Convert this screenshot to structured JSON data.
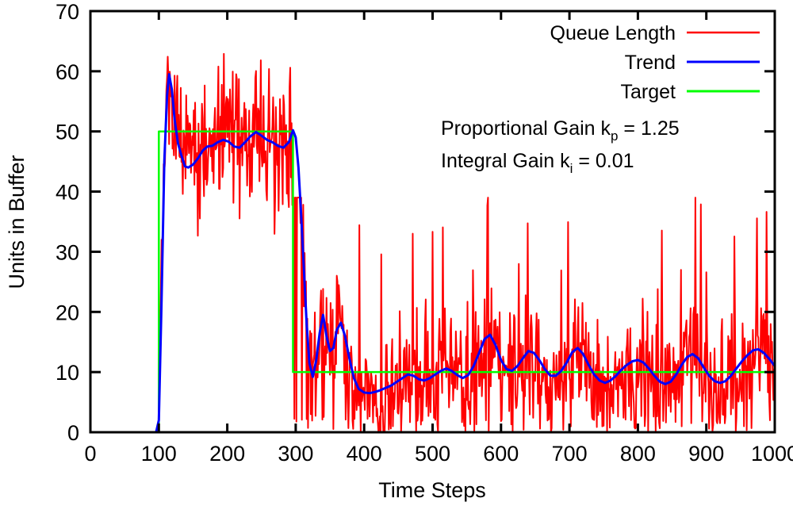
{
  "chart_data": {
    "type": "line",
    "title": "",
    "xlabel": "Time Steps",
    "ylabel": "Units in Buffer",
    "xlim": [
      0,
      1000
    ],
    "ylim": [
      0,
      70
    ],
    "xticks": [
      0,
      100,
      200,
      300,
      400,
      500,
      600,
      700,
      800,
      900,
      1000
    ],
    "yticks": [
      0,
      10,
      20,
      30,
      40,
      50,
      60,
      70
    ],
    "grid": false,
    "legend_position": "top-right",
    "legend": [
      {
        "name": "Queue Length",
        "color": "#FF0000"
      },
      {
        "name": "Trend",
        "color": "#0000FF"
      },
      {
        "name": "Target",
        "color": "#00C000"
      }
    ],
    "annotations": [
      {
        "text": "Proportional Gain k",
        "sub": "p",
        "tail": " = 1.25"
      },
      {
        "text": "Integral Gain k",
        "sub": "i",
        "tail": " = 0.01"
      }
    ],
    "series": [
      {
        "name": "Target",
        "color": "#00FF00",
        "width": 2.5,
        "x": [
          0,
          100,
          100,
          296,
          296,
          1000
        ],
        "values": [
          0,
          0,
          50,
          50,
          10,
          10
        ]
      },
      {
        "name": "Trend",
        "color": "#0000FF",
        "width": 3,
        "x": [
          0,
          20,
          40,
          60,
          80,
          96,
          100,
          104,
          108,
          112,
          115,
          119,
          123,
          128,
          133,
          138,
          143,
          150,
          157,
          164,
          171,
          178,
          186,
          194,
          202,
          210,
          218,
          226,
          234,
          242,
          250,
          258,
          266,
          274,
          282,
          290,
          296,
          300,
          304,
          308,
          312,
          316,
          320,
          325,
          330,
          335,
          340,
          345,
          350,
          355,
          360,
          366,
          372,
          378,
          385,
          392,
          400,
          408,
          416,
          424,
          432,
          440,
          448,
          456,
          464,
          472,
          480,
          488,
          496,
          504,
          512,
          520,
          528,
          536,
          544,
          552,
          560,
          568,
          576,
          584,
          592,
          600,
          608,
          616,
          624,
          632,
          640,
          648,
          656,
          664,
          672,
          680,
          688,
          696,
          704,
          712,
          720,
          728,
          736,
          744,
          752,
          760,
          768,
          776,
          784,
          792,
          800,
          808,
          816,
          824,
          832,
          840,
          848,
          856,
          864,
          872,
          880,
          888,
          896,
          904,
          912,
          920,
          928,
          936,
          944,
          952,
          960,
          968,
          976,
          984,
          992,
          1000
        ],
        "values": [
          0,
          0,
          0,
          0,
          0,
          0,
          2,
          22,
          45,
          56,
          59.5,
          57,
          52,
          48,
          46,
          44.2,
          44,
          44.5,
          45.5,
          46.8,
          47.5,
          47.6,
          48.2,
          48.6,
          48.3,
          47.5,
          47.3,
          48.2,
          49.2,
          49.9,
          49.3,
          48.6,
          48.2,
          47.6,
          47.3,
          48.2,
          50.2,
          49,
          44,
          36,
          27,
          18,
          11.5,
          9.2,
          12,
          16.5,
          19.5,
          16,
          13.5,
          14,
          17,
          18.2,
          16,
          12.5,
          9,
          7.2,
          6.6,
          6.5,
          6.7,
          7,
          7.4,
          7.8,
          8.4,
          9,
          9.6,
          9.4,
          8.8,
          8.6,
          9,
          9.6,
          10.2,
          10.6,
          10.2,
          9.5,
          9,
          9.5,
          11,
          13.2,
          15.5,
          16.2,
          14.5,
          12,
          10.5,
          10.2,
          11,
          12.3,
          13.5,
          13.2,
          12,
          10.5,
          9.4,
          9.4,
          10.2,
          11.6,
          13.3,
          14,
          13,
          11.2,
          9.6,
          8.6,
          8.2,
          8.6,
          9.4,
          10.4,
          11.2,
          11.8,
          12,
          11.6,
          10.6,
          9.4,
          8.4,
          8,
          8.4,
          9.6,
          11.2,
          12.5,
          13,
          12.3,
          10.8,
          9.4,
          8.5,
          8.2,
          8.5,
          9.4,
          10.6,
          11.8,
          12.8,
          13.6,
          13.8,
          13.2,
          12.2,
          11,
          9.8,
          9.2
        ]
      },
      {
        "name": "Queue Length",
        "color": "#FF0000",
        "width": 2,
        "noise": {
          "pre_value": 0,
          "plateau_mean": 48,
          "plateau_spread": 16,
          "plateau_max": 66,
          "plateau_min": 34,
          "tail_mean": 11,
          "tail_spread": 11,
          "tail_max": 39,
          "tail_min": 0,
          "seed": 1337
        }
      }
    ]
  },
  "axes": {
    "y_label": "Units in Buffer",
    "x_label": "Time Steps",
    "y_tick_labels": [
      "0",
      "10",
      "20",
      "30",
      "40",
      "50",
      "60",
      "70"
    ],
    "x_tick_labels": [
      "0",
      "100",
      "200",
      "300",
      "400",
      "500",
      "600",
      "700",
      "800",
      "900",
      "1000"
    ]
  },
  "legend": {
    "items": [
      {
        "label": "Queue Length",
        "color": "#FF0000"
      },
      {
        "label": "Trend",
        "color": "#0000FF"
      },
      {
        "label": "Target",
        "color": "#00C000"
      }
    ]
  },
  "annotations": {
    "line1_main": "Proportional Gain k",
    "line1_sub": "p",
    "line1_tail": " = 1.25",
    "line2_main": "Integral Gain k",
    "line2_sub": "i",
    "line2_tail": " = 0.01"
  }
}
